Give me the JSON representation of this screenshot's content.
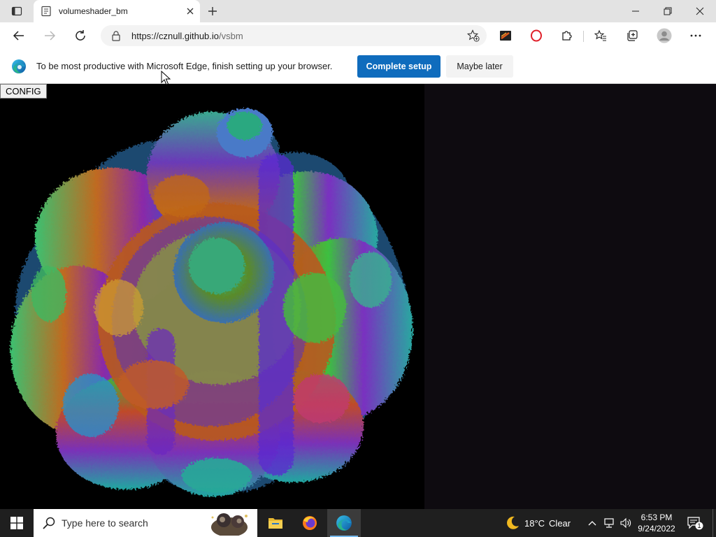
{
  "browser": {
    "tab_title": "volumeshader_bm",
    "url_host": "https://cznull.github.io",
    "url_path": "/vsbm"
  },
  "infobar": {
    "message": "To be most productive with Microsoft Edge, finish setting up your browser.",
    "primary_button": "Complete setup",
    "secondary_button": "Maybe later"
  },
  "page": {
    "config_label": "CONFIG"
  },
  "taskbar": {
    "search_placeholder": "Type here to search",
    "weather_temp": "18°C",
    "weather_desc": "Clear",
    "time": "6:53 PM",
    "date": "9/24/2022",
    "notification_count": "1"
  },
  "colors": {
    "accent": "#0f6cbd",
    "taskbar": "#1f1f1f",
    "titlebar": "#e3e3e3"
  }
}
